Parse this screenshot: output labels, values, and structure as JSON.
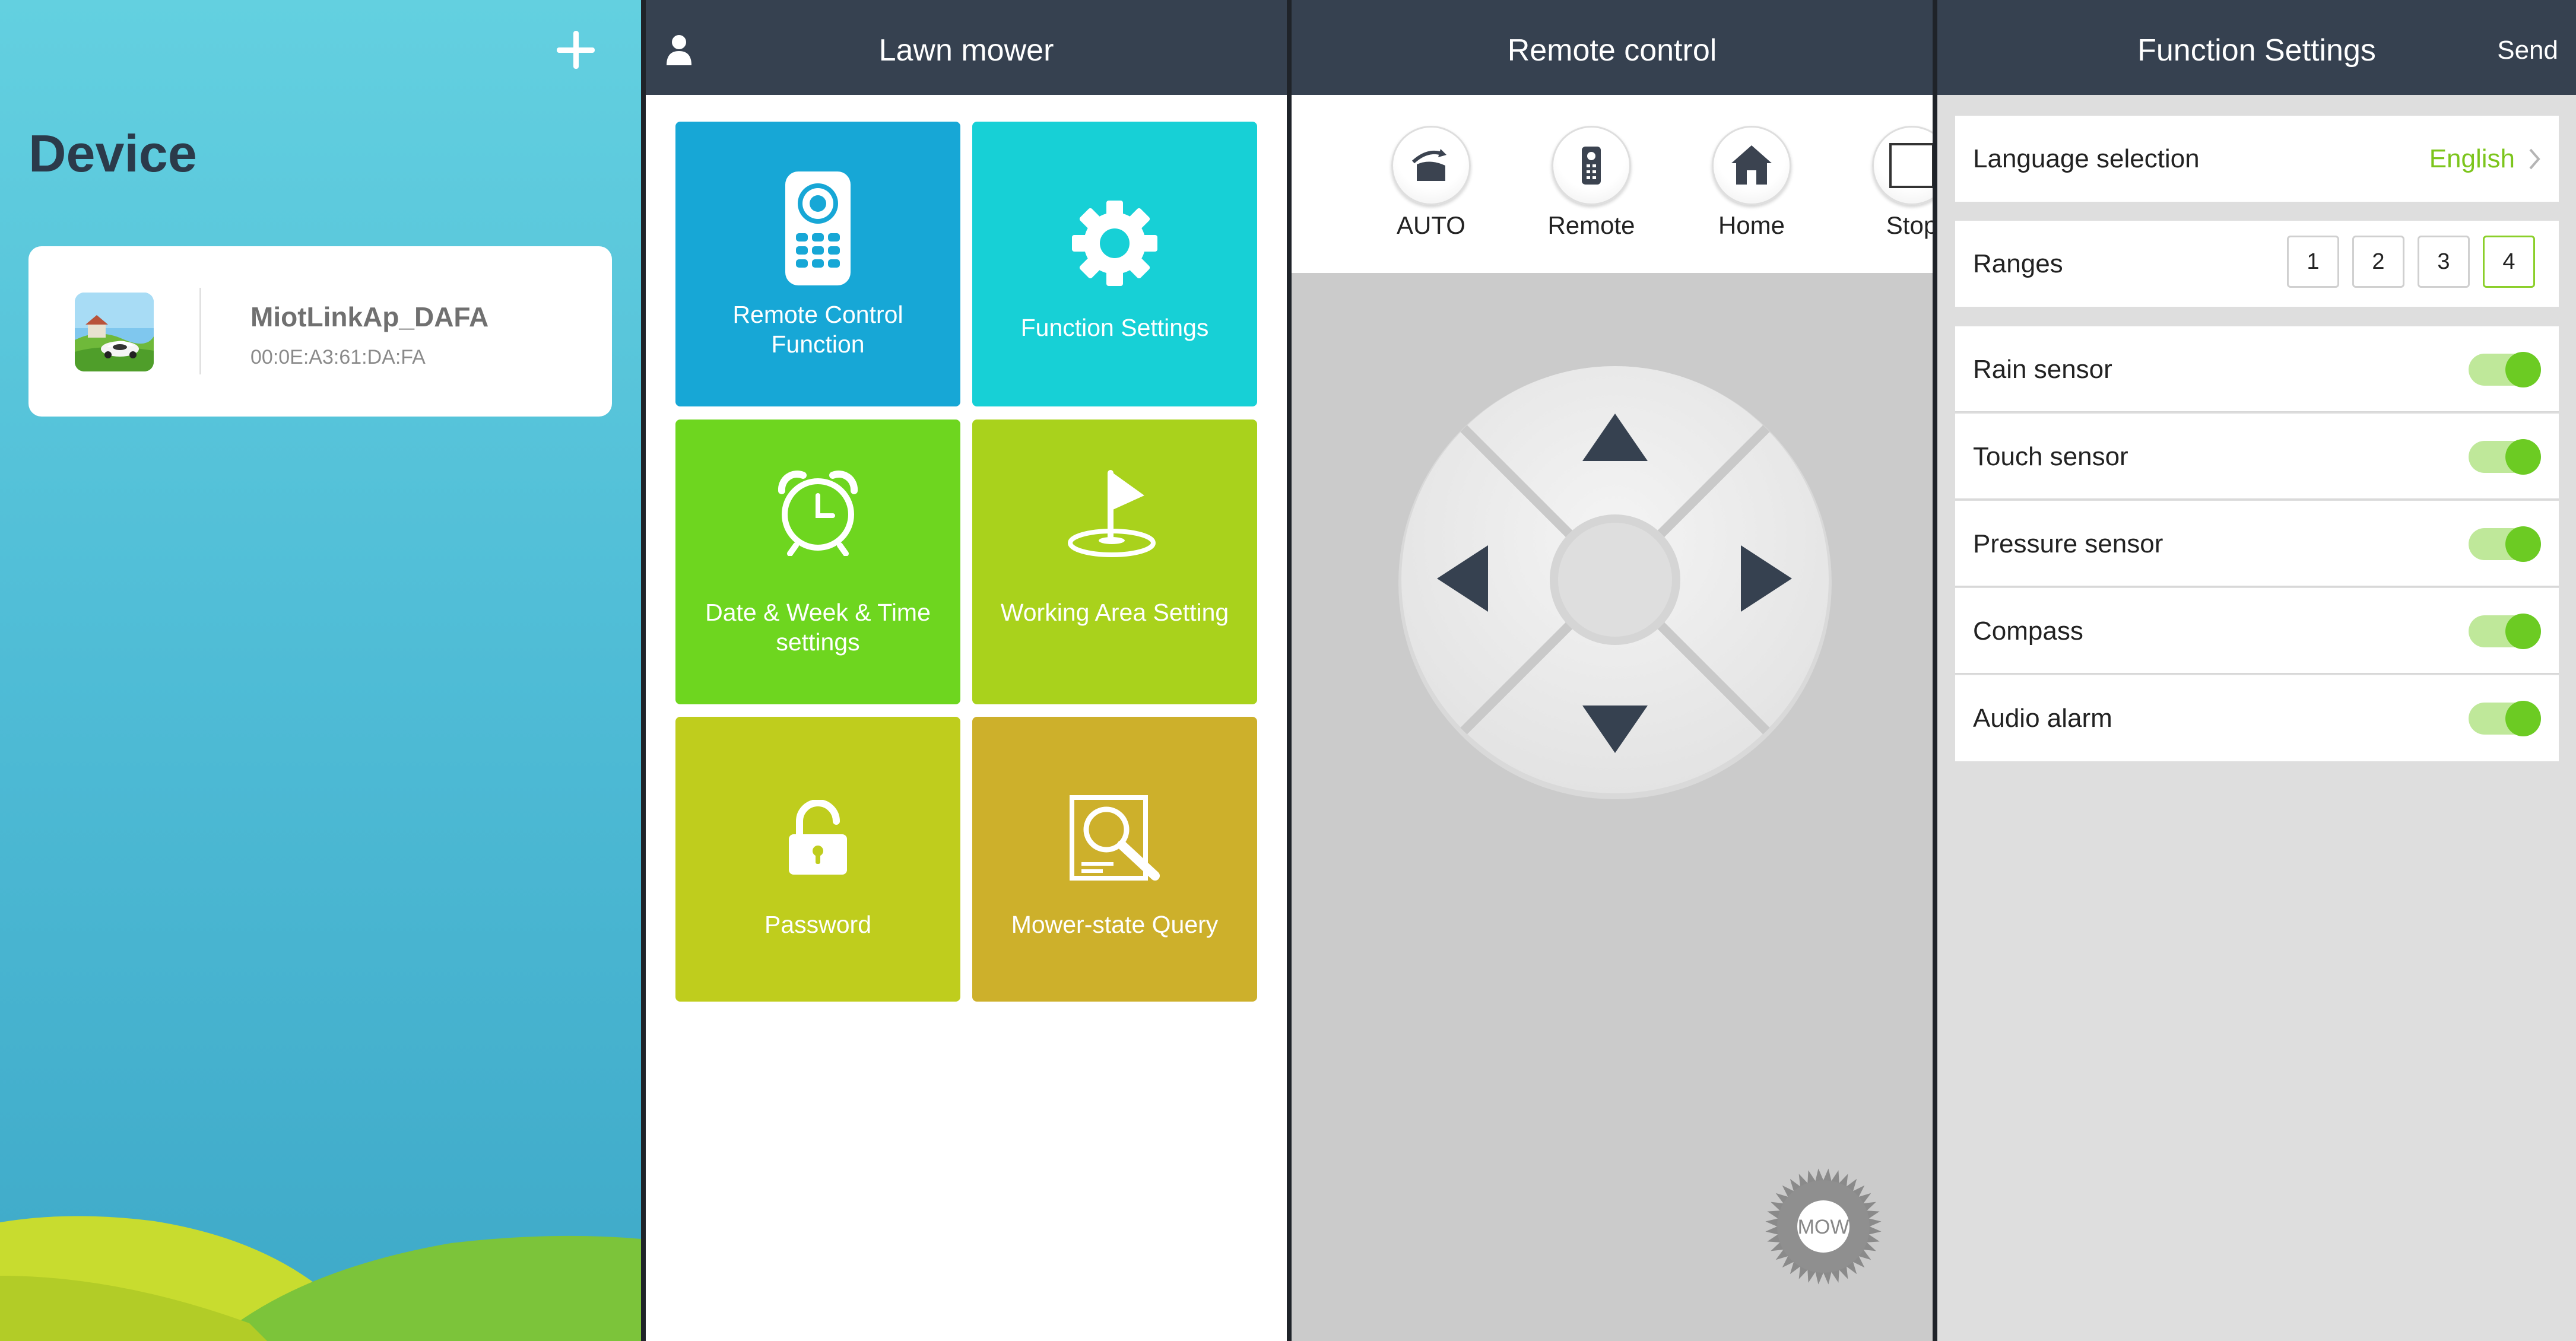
{
  "device": {
    "title": "Device",
    "add_icon": "plus-icon",
    "card": {
      "name": "MiotLinkAp_DAFA",
      "mac": "00:0E:A3:61:DA:FA",
      "thumb_icon": "mower-thumbnail"
    }
  },
  "lawn": {
    "title": "Lawn mower",
    "user_icon": "user-icon",
    "tiles": [
      {
        "label": "Remote Control Function",
        "icon": "remote-control-icon",
        "color": "#17a7d6"
      },
      {
        "label": "Function Settings",
        "icon": "gear-icon",
        "color": "#17d0d6"
      },
      {
        "label": "Date & Week & Time settings",
        "icon": "alarm-clock-icon",
        "color": "#6ed61f"
      },
      {
        "label": "Working Area Setting",
        "icon": "flag-icon",
        "color": "#a9d21c"
      },
      {
        "label": "Password",
        "icon": "unlock-icon",
        "color": "#bfcd1d"
      },
      {
        "label": "Mower-state Query",
        "icon": "search-document-icon",
        "color": "#cdb02b"
      }
    ]
  },
  "remote": {
    "title": "Remote control",
    "modes": [
      {
        "label": "AUTO",
        "icon": "auto-mow-icon"
      },
      {
        "label": "Remote",
        "icon": "remote-icon"
      },
      {
        "label": "Home",
        "icon": "home-icon"
      },
      {
        "label": "Stop",
        "icon": "stop-icon"
      }
    ],
    "mow_label": "MOW"
  },
  "settings": {
    "title": "Function Settings",
    "send_label": "Send",
    "language": {
      "label": "Language selection",
      "value": "English"
    },
    "ranges": {
      "label": "Ranges",
      "options": [
        "1",
        "2",
        "3",
        "4"
      ],
      "selected": "4"
    },
    "toggles": [
      {
        "label": "Rain sensor",
        "on": true
      },
      {
        "label": "Touch sensor",
        "on": true
      },
      {
        "label": "Pressure sensor",
        "on": true
      },
      {
        "label": "Compass",
        "on": true
      },
      {
        "label": "Audio alarm",
        "on": true
      }
    ],
    "accent": "#6ccb23"
  }
}
